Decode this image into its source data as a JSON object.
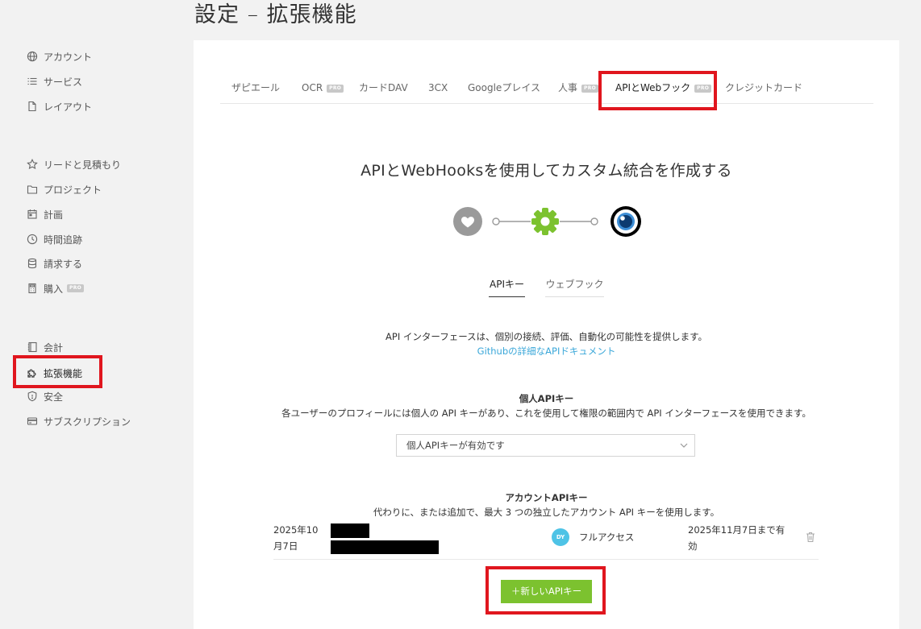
{
  "page": {
    "title": "設定 – 拡張機能"
  },
  "sidebar": {
    "items": [
      {
        "label": "アカウント",
        "icon": "globe-icon"
      },
      {
        "label": "サービス",
        "icon": "list-icon"
      },
      {
        "label": "レイアウト",
        "icon": "file-icon"
      },
      {
        "label": "リードと見積もり",
        "icon": "star-icon"
      },
      {
        "label": "プロジェクト",
        "icon": "folder-icon"
      },
      {
        "label": "計画",
        "icon": "calendar-icon"
      },
      {
        "label": "時間追跡",
        "icon": "clock-icon"
      },
      {
        "label": "請求する",
        "icon": "database-icon"
      },
      {
        "label": "購入",
        "icon": "calculator-icon",
        "badge": "PRO"
      },
      {
        "label": "会計",
        "icon": "book-icon"
      },
      {
        "label": "拡張機能",
        "icon": "puzzle-icon",
        "active": true
      },
      {
        "label": "安全",
        "icon": "shield-icon"
      },
      {
        "label": "サブスクリプション",
        "icon": "credit-card-icon"
      }
    ]
  },
  "tabs": [
    {
      "label": "ザピエール"
    },
    {
      "label": "OCR",
      "badge": "PRO"
    },
    {
      "label": "カードDAV"
    },
    {
      "label": "3CX"
    },
    {
      "label": "Googleプレイス"
    },
    {
      "label": "人事",
      "badge": "PRO"
    },
    {
      "label": "APIとWebフック",
      "badge": "PRO",
      "active": true
    },
    {
      "label": "クレジットカード"
    }
  ],
  "main": {
    "heading": "APIとWebHooksを使用してカスタム統合を作成する",
    "steps": [
      "heart-icon",
      "gear-icon",
      "eye-icon"
    ],
    "colors": {
      "accent": "#7cc22f",
      "link": "#3aa7d9",
      "highlight": "#e0161e",
      "avatar": "#4ec3e6"
    },
    "subtabs": [
      {
        "label": "APIキー",
        "active": true
      },
      {
        "label": "ウェブフック"
      }
    ],
    "intro": "API インターフェースは、個別の接続、評価、自動化の可能性を提供します。",
    "doc_link": "Githubの詳細なAPIドキュメント",
    "personal": {
      "title": "個人APIキー",
      "description": "各ユーザーのプロフィールには個人の API キーがあり、これを使用して権限の範囲内で API インターフェースを使用できます。",
      "select_value": "個人APIキーが有効です"
    },
    "account": {
      "title": "アカウントAPIキー",
      "description": "代わりに、または追加で、最大 3 つの独立したアカウント API キーを使用します。",
      "keys": [
        {
          "created_line1": "2025年10",
          "created_line2": "月7日",
          "user_initials": "DY",
          "access": "フルアクセス",
          "valid_line1": "2025年11月7日まで有",
          "valid_line2": "効"
        }
      ],
      "new_button": "＋新しいAPIキー"
    }
  }
}
